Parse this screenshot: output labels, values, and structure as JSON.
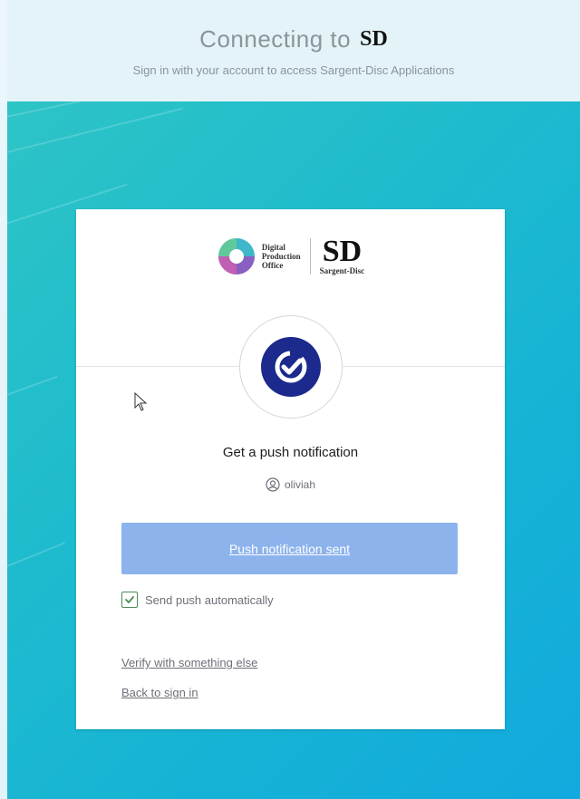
{
  "header": {
    "title": "Connecting to",
    "logo_text": "SD",
    "subtitle": "Sign in with your account to access Sargent-Disc Applications"
  },
  "card": {
    "logos": {
      "dpo_line1": "Digital",
      "dpo_line2": "Production",
      "dpo_line3": "Office",
      "sd_mark": "SD",
      "sd_name": "Sargent-Disc"
    },
    "push_title": "Get a push notification",
    "username": "oliviah",
    "push_button_label": "Push notification sent",
    "auto_push_label": "Send push automatically",
    "auto_push_checked": true,
    "verify_else_link": "Verify with something else",
    "back_link": "Back to sign in"
  },
  "icons": {
    "verify": "okta-verify-check-icon",
    "user": "user-circle-icon",
    "cursor": "mouse-pointer-icon",
    "checkbox": "checkmark-icon"
  },
  "colors": {
    "button": "#8db3ed",
    "verify_icon": "#1b2a8c",
    "bg_start": "#2dc4c6",
    "bg_end": "#12a9de",
    "checkbox": "#4a8a4f"
  }
}
